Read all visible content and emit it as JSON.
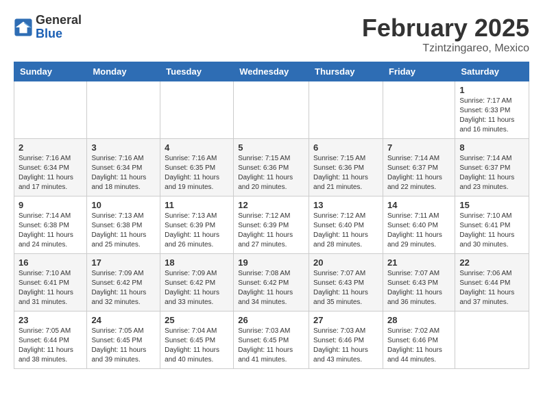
{
  "header": {
    "logo_general": "General",
    "logo_blue": "Blue",
    "month_title": "February 2025",
    "location": "Tzintzingareo, Mexico"
  },
  "weekdays": [
    "Sunday",
    "Monday",
    "Tuesday",
    "Wednesday",
    "Thursday",
    "Friday",
    "Saturday"
  ],
  "weeks": [
    [
      {
        "day": "",
        "info": ""
      },
      {
        "day": "",
        "info": ""
      },
      {
        "day": "",
        "info": ""
      },
      {
        "day": "",
        "info": ""
      },
      {
        "day": "",
        "info": ""
      },
      {
        "day": "",
        "info": ""
      },
      {
        "day": "1",
        "info": "Sunrise: 7:17 AM\nSunset: 6:33 PM\nDaylight: 11 hours and 16 minutes."
      }
    ],
    [
      {
        "day": "2",
        "info": "Sunrise: 7:16 AM\nSunset: 6:34 PM\nDaylight: 11 hours and 17 minutes."
      },
      {
        "day": "3",
        "info": "Sunrise: 7:16 AM\nSunset: 6:34 PM\nDaylight: 11 hours and 18 minutes."
      },
      {
        "day": "4",
        "info": "Sunrise: 7:16 AM\nSunset: 6:35 PM\nDaylight: 11 hours and 19 minutes."
      },
      {
        "day": "5",
        "info": "Sunrise: 7:15 AM\nSunset: 6:36 PM\nDaylight: 11 hours and 20 minutes."
      },
      {
        "day": "6",
        "info": "Sunrise: 7:15 AM\nSunset: 6:36 PM\nDaylight: 11 hours and 21 minutes."
      },
      {
        "day": "7",
        "info": "Sunrise: 7:14 AM\nSunset: 6:37 PM\nDaylight: 11 hours and 22 minutes."
      },
      {
        "day": "8",
        "info": "Sunrise: 7:14 AM\nSunset: 6:37 PM\nDaylight: 11 hours and 23 minutes."
      }
    ],
    [
      {
        "day": "9",
        "info": "Sunrise: 7:14 AM\nSunset: 6:38 PM\nDaylight: 11 hours and 24 minutes."
      },
      {
        "day": "10",
        "info": "Sunrise: 7:13 AM\nSunset: 6:38 PM\nDaylight: 11 hours and 25 minutes."
      },
      {
        "day": "11",
        "info": "Sunrise: 7:13 AM\nSunset: 6:39 PM\nDaylight: 11 hours and 26 minutes."
      },
      {
        "day": "12",
        "info": "Sunrise: 7:12 AM\nSunset: 6:39 PM\nDaylight: 11 hours and 27 minutes."
      },
      {
        "day": "13",
        "info": "Sunrise: 7:12 AM\nSunset: 6:40 PM\nDaylight: 11 hours and 28 minutes."
      },
      {
        "day": "14",
        "info": "Sunrise: 7:11 AM\nSunset: 6:40 PM\nDaylight: 11 hours and 29 minutes."
      },
      {
        "day": "15",
        "info": "Sunrise: 7:10 AM\nSunset: 6:41 PM\nDaylight: 11 hours and 30 minutes."
      }
    ],
    [
      {
        "day": "16",
        "info": "Sunrise: 7:10 AM\nSunset: 6:41 PM\nDaylight: 11 hours and 31 minutes."
      },
      {
        "day": "17",
        "info": "Sunrise: 7:09 AM\nSunset: 6:42 PM\nDaylight: 11 hours and 32 minutes."
      },
      {
        "day": "18",
        "info": "Sunrise: 7:09 AM\nSunset: 6:42 PM\nDaylight: 11 hours and 33 minutes."
      },
      {
        "day": "19",
        "info": "Sunrise: 7:08 AM\nSunset: 6:42 PM\nDaylight: 11 hours and 34 minutes."
      },
      {
        "day": "20",
        "info": "Sunrise: 7:07 AM\nSunset: 6:43 PM\nDaylight: 11 hours and 35 minutes."
      },
      {
        "day": "21",
        "info": "Sunrise: 7:07 AM\nSunset: 6:43 PM\nDaylight: 11 hours and 36 minutes."
      },
      {
        "day": "22",
        "info": "Sunrise: 7:06 AM\nSunset: 6:44 PM\nDaylight: 11 hours and 37 minutes."
      }
    ],
    [
      {
        "day": "23",
        "info": "Sunrise: 7:05 AM\nSunset: 6:44 PM\nDaylight: 11 hours and 38 minutes."
      },
      {
        "day": "24",
        "info": "Sunrise: 7:05 AM\nSunset: 6:45 PM\nDaylight: 11 hours and 39 minutes."
      },
      {
        "day": "25",
        "info": "Sunrise: 7:04 AM\nSunset: 6:45 PM\nDaylight: 11 hours and 40 minutes."
      },
      {
        "day": "26",
        "info": "Sunrise: 7:03 AM\nSunset: 6:45 PM\nDaylight: 11 hours and 41 minutes."
      },
      {
        "day": "27",
        "info": "Sunrise: 7:03 AM\nSunset: 6:46 PM\nDaylight: 11 hours and 43 minutes."
      },
      {
        "day": "28",
        "info": "Sunrise: 7:02 AM\nSunset: 6:46 PM\nDaylight: 11 hours and 44 minutes."
      },
      {
        "day": "",
        "info": ""
      }
    ]
  ]
}
